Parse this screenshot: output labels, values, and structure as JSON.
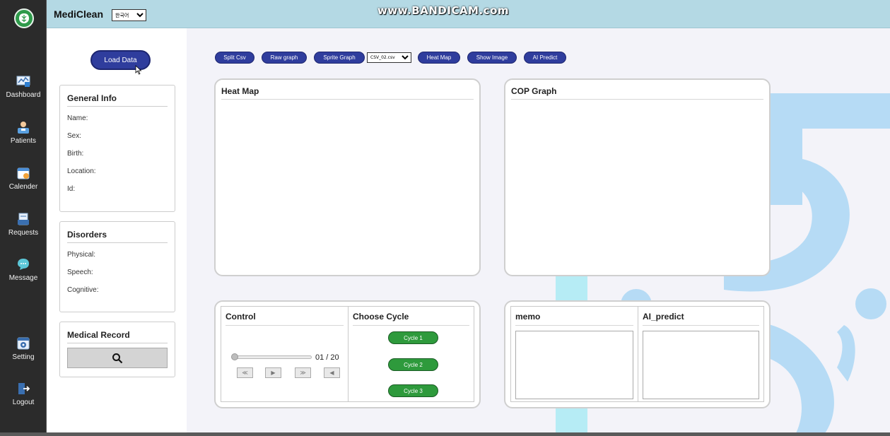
{
  "app": {
    "title": "MediClean",
    "language": "한국어"
  },
  "watermark": "www.BANDICAM.com",
  "nav": [
    {
      "label": "Dashboard",
      "icon": "dashboard-icon"
    },
    {
      "label": "Patients",
      "icon": "patients-icon"
    },
    {
      "label": "Calender",
      "icon": "calendar-icon"
    },
    {
      "label": "Requests",
      "icon": "requests-icon"
    },
    {
      "label": "Message",
      "icon": "message-icon"
    },
    {
      "label": "Setting",
      "icon": "setting-icon"
    },
    {
      "label": "Logout",
      "icon": "logout-icon"
    }
  ],
  "left": {
    "load_button": "Load Data",
    "general_info": {
      "title": "General Info",
      "fields": [
        "Name:",
        "Sex:",
        "Birth:",
        "Location:",
        "Id:"
      ]
    },
    "disorders": {
      "title": "Disorders",
      "fields": [
        "Physical:",
        "Speech:",
        "Cognitive:"
      ]
    },
    "medical_record": {
      "title": "Medical Record",
      "search_icon": "search-icon"
    }
  },
  "toolbar": {
    "split_csv": "Split Csv",
    "raw_graph": "Raw graph",
    "sprite_graph": "Sprite Graph",
    "csv_file": "CSV_02.csv",
    "heat_map": "Heat Map",
    "show_image": "Show Image",
    "ai_predict": "AI Predict"
  },
  "panels": {
    "heat_map": "Heat Map",
    "cop_graph": "COP Graph",
    "control": {
      "title": "Control",
      "frame": "01 / 20",
      "frame_progress": 0.0,
      "buttons": [
        "≪",
        "▶",
        "≫",
        "◀"
      ]
    },
    "choose_cycle": {
      "title": "Choose Cycle",
      "cycles": [
        "Cycle 1",
        "Cycle 2",
        "Cycle 3"
      ]
    },
    "memo": "memo",
    "ai_predict": "AI_predict"
  },
  "colors": {
    "header_bg": "#b4d9e4",
    "sidebar_bg": "#2b2b2b",
    "primary_button": "#2f3d9d",
    "cycle_button": "#2e9a3c",
    "bg_decoration": "#b6dbf5"
  }
}
